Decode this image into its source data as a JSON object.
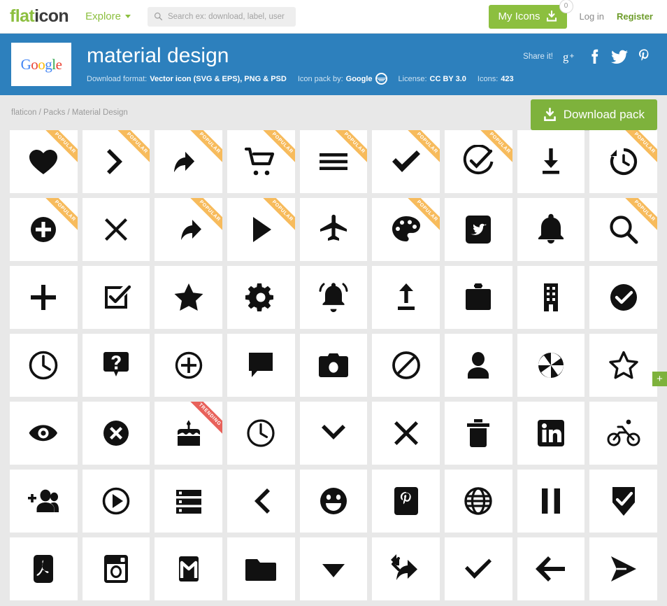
{
  "topnav": {
    "logo_part1": "flat",
    "logo_part2": "icon",
    "explore_label": "Explore",
    "search_placeholder": "Search ex: download, label, user",
    "my_icons_label": "My Icons",
    "my_icons_count": "0",
    "login_label": "Log in",
    "register_label": "Register"
  },
  "banner": {
    "pack_logo_text": "Google",
    "title": "material design",
    "download_format_label": "Download format:",
    "download_format_value": "Vector icon (SVG & EPS), PNG & PSD",
    "icon_pack_by_label": "Icon pack by:",
    "icon_pack_by_value": "Google",
    "license_label": "License:",
    "license_value": "CC BY 3.0",
    "icons_label": "Icons:",
    "icons_value": "423",
    "share_label": "Share it!",
    "share_targets": [
      "google-plus",
      "facebook",
      "twitter",
      "pinterest"
    ],
    "bg_color": "#2d80bd"
  },
  "crumbbar": {
    "breadcrumb": "flaticon / Packs / Material Design",
    "download_pack_label": "Download pack",
    "download_pack_color": "#7eb23c"
  },
  "grid": {
    "plus_tab_label": "+",
    "ribbon_popular": "POPULAR",
    "ribbon_trending": "TRENDING",
    "ribbon_popular_color": "#f7bb5c",
    "ribbon_trending_color": "#e8615a",
    "icons": [
      {
        "name": "heart-icon",
        "ribbon": "popular"
      },
      {
        "name": "chevron-right-icon",
        "ribbon": "popular"
      },
      {
        "name": "reply-icon",
        "ribbon": "popular"
      },
      {
        "name": "shopping-cart-icon",
        "ribbon": "popular"
      },
      {
        "name": "menu-icon",
        "ribbon": "popular"
      },
      {
        "name": "check-icon",
        "ribbon": "popular"
      },
      {
        "name": "check-circle-outline-icon",
        "ribbon": "popular"
      },
      {
        "name": "download-icon",
        "ribbon": "none"
      },
      {
        "name": "history-icon",
        "ribbon": "popular"
      },
      {
        "name": "add-circle-icon",
        "ribbon": "popular"
      },
      {
        "name": "close-icon",
        "ribbon": "none"
      },
      {
        "name": "forward-icon",
        "ribbon": "popular"
      },
      {
        "name": "play-arrow-icon",
        "ribbon": "popular"
      },
      {
        "name": "flight-icon",
        "ribbon": "none"
      },
      {
        "name": "palette-icon",
        "ribbon": "popular"
      },
      {
        "name": "twitter-icon",
        "ribbon": "none"
      },
      {
        "name": "bell-icon",
        "ribbon": "none"
      },
      {
        "name": "search-icon",
        "ribbon": "popular"
      },
      {
        "name": "plus-icon",
        "ribbon": "none"
      },
      {
        "name": "note-check-icon",
        "ribbon": "none"
      },
      {
        "name": "star-icon",
        "ribbon": "none"
      },
      {
        "name": "settings-gear-icon",
        "ribbon": "none"
      },
      {
        "name": "bell-active-icon",
        "ribbon": "none"
      },
      {
        "name": "upload-icon",
        "ribbon": "none"
      },
      {
        "name": "briefcase-icon",
        "ribbon": "none"
      },
      {
        "name": "business-building-icon",
        "ribbon": "none"
      },
      {
        "name": "check-circle-filled-icon",
        "ribbon": "none"
      },
      {
        "name": "clock-icon",
        "ribbon": "none"
      },
      {
        "name": "help-question-icon",
        "ribbon": "none"
      },
      {
        "name": "add-circle-outline-icon",
        "ribbon": "none"
      },
      {
        "name": "comment-icon",
        "ribbon": "none"
      },
      {
        "name": "camera-icon",
        "ribbon": "none"
      },
      {
        "name": "block-icon",
        "ribbon": "none"
      },
      {
        "name": "person-icon",
        "ribbon": "none"
      },
      {
        "name": "aperture-icon",
        "ribbon": "none"
      },
      {
        "name": "star-outline-icon",
        "ribbon": "none"
      },
      {
        "name": "visibility-eye-icon",
        "ribbon": "none"
      },
      {
        "name": "close-circle-icon",
        "ribbon": "none"
      },
      {
        "name": "cake-icon",
        "ribbon": "trending"
      },
      {
        "name": "clock-outline-icon",
        "ribbon": "none"
      },
      {
        "name": "chevron-down-icon",
        "ribbon": "none"
      },
      {
        "name": "close-x-icon",
        "ribbon": "none"
      },
      {
        "name": "trash-icon",
        "ribbon": "none"
      },
      {
        "name": "linkedin-icon",
        "ribbon": "none"
      },
      {
        "name": "bike-icon",
        "ribbon": "none"
      },
      {
        "name": "add-person-icon",
        "ribbon": "none"
      },
      {
        "name": "play-circle-icon",
        "ribbon": "none"
      },
      {
        "name": "storage-list-icon",
        "ribbon": "none"
      },
      {
        "name": "chevron-left-icon",
        "ribbon": "none"
      },
      {
        "name": "smiley-face-icon",
        "ribbon": "none"
      },
      {
        "name": "pinterest-icon",
        "ribbon": "none"
      },
      {
        "name": "globe-icon",
        "ribbon": "none"
      },
      {
        "name": "pause-icon",
        "ribbon": "none"
      },
      {
        "name": "verified-shield-icon",
        "ribbon": "none"
      },
      {
        "name": "pdf-icon",
        "ribbon": "none"
      },
      {
        "name": "instagram-icon",
        "ribbon": "none"
      },
      {
        "name": "gmail-icon",
        "ribbon": "none"
      },
      {
        "name": "folder-icon",
        "ribbon": "none"
      },
      {
        "name": "arrow-drop-down-icon",
        "ribbon": "none"
      },
      {
        "name": "reply-all-icon",
        "ribbon": "none"
      },
      {
        "name": "check-mark-icon",
        "ribbon": "none"
      },
      {
        "name": "arrow-back-icon",
        "ribbon": "none"
      },
      {
        "name": "send-icon",
        "ribbon": "none"
      }
    ]
  }
}
